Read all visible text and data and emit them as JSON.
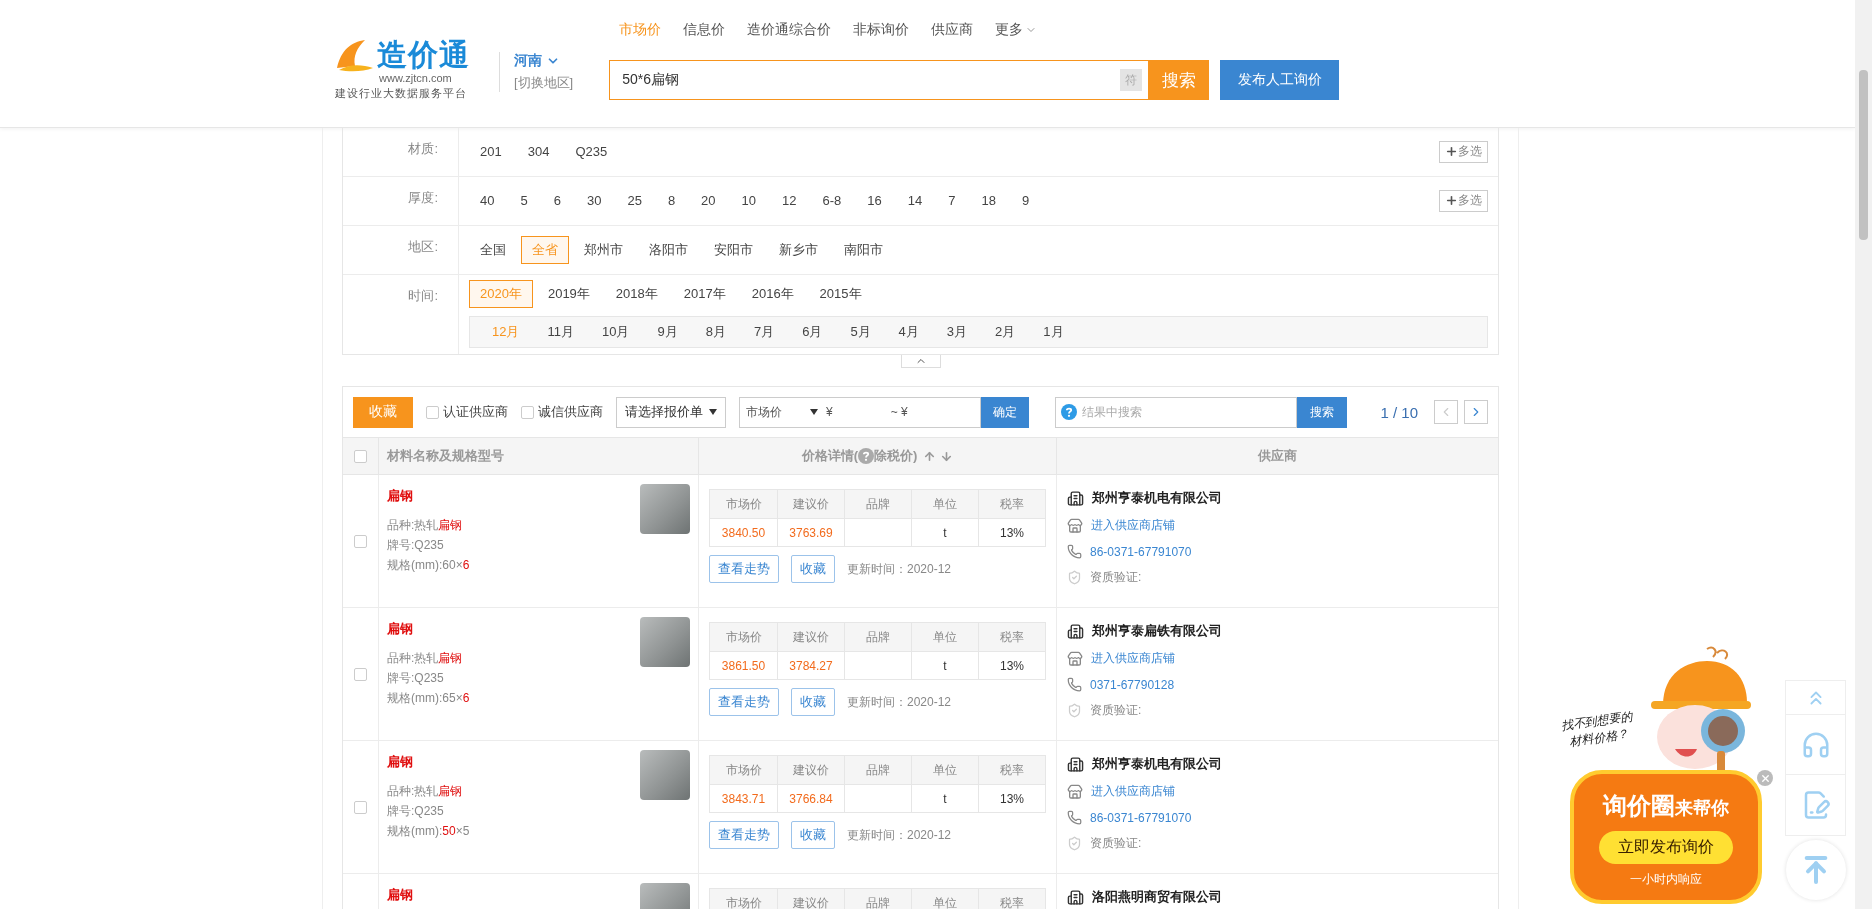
{
  "header": {
    "logo": {
      "name": "造价通",
      "url": "www.zjtcn.com",
      "slogan": "建设行业大数据服务平台"
    },
    "region": {
      "name": "河南",
      "switch": "[切换地区]"
    },
    "nav": [
      {
        "label": "市场价",
        "selected": true,
        "kind": "link"
      },
      {
        "label": "信息价",
        "selected": false,
        "kind": "link"
      },
      {
        "label": "造价通综合价",
        "selected": false,
        "kind": "link"
      },
      {
        "label": "非标询价",
        "selected": false,
        "kind": "link"
      },
      {
        "label": "供应商",
        "selected": false,
        "kind": "link"
      },
      {
        "label": "更多",
        "selected": false,
        "kind": "dropdown"
      }
    ],
    "search": {
      "value": "50*6扁钢",
      "symbol_button": "符",
      "button": "搜索"
    },
    "publish_button": "发布人工询价"
  },
  "filters": [
    {
      "label": "材质:",
      "multi": "多选",
      "options": [
        {
          "label": "201",
          "selected": false
        },
        {
          "label": "304",
          "selected": false
        },
        {
          "label": "Q235",
          "selected": false
        }
      ]
    },
    {
      "label": "厚度:",
      "multi": "多选",
      "options": [
        {
          "label": "40",
          "selected": false
        },
        {
          "label": "5",
          "selected": false
        },
        {
          "label": "6",
          "selected": false
        },
        {
          "label": "30",
          "selected": false
        },
        {
          "label": "25",
          "selected": false
        },
        {
          "label": "8",
          "selected": false
        },
        {
          "label": "20",
          "selected": false
        },
        {
          "label": "10",
          "selected": false
        },
        {
          "label": "12",
          "selected": false
        },
        {
          "label": "6-8",
          "selected": false
        },
        {
          "label": "16",
          "selected": false
        },
        {
          "label": "14",
          "selected": false
        },
        {
          "label": "7",
          "selected": false
        },
        {
          "label": "18",
          "selected": false
        },
        {
          "label": "9",
          "selected": false
        }
      ]
    },
    {
      "label": "地区:",
      "options": [
        {
          "label": "全国",
          "selected": false
        },
        {
          "label": "全省",
          "selected": true
        },
        {
          "label": "郑州市",
          "selected": false
        },
        {
          "label": "洛阳市",
          "selected": false
        },
        {
          "label": "安阳市",
          "selected": false
        },
        {
          "label": "新乡市",
          "selected": false
        },
        {
          "label": "南阳市",
          "selected": false
        }
      ]
    },
    {
      "label": "时间:",
      "options": [
        {
          "label": "2020年",
          "selected": true
        },
        {
          "label": "2019年",
          "selected": false
        },
        {
          "label": "2018年",
          "selected": false
        },
        {
          "label": "2017年",
          "selected": false
        },
        {
          "label": "2016年",
          "selected": false
        },
        {
          "label": "2015年",
          "selected": false
        }
      ],
      "months": [
        {
          "label": "12月",
          "selected": true
        },
        {
          "label": "11月",
          "selected": false
        },
        {
          "label": "10月",
          "selected": false
        },
        {
          "label": "9月",
          "selected": false
        },
        {
          "label": "8月",
          "selected": false
        },
        {
          "label": "7月",
          "selected": false
        },
        {
          "label": "6月",
          "selected": false
        },
        {
          "label": "5月",
          "selected": false
        },
        {
          "label": "4月",
          "selected": false
        },
        {
          "label": "3月",
          "selected": false
        },
        {
          "label": "2月",
          "selected": false
        },
        {
          "label": "1月",
          "selected": false
        }
      ]
    }
  ],
  "toolbar": {
    "collect_button": "收藏",
    "checkboxes": [
      {
        "label": "认证供应商",
        "checked": false
      },
      {
        "label": "诚信供应商",
        "checked": false
      }
    ],
    "quote_select": "请选择报价单",
    "price_type": "市场价",
    "price_from": "¥",
    "price_to": "~ ¥",
    "confirm_button": "确定",
    "result_search": {
      "placeholder": "结果中搜索",
      "button": "搜索"
    },
    "pager": "1 / 10"
  },
  "table": {
    "select_all_checked": false,
    "columns": [
      {
        "kind": "name",
        "label": "材料名称及规格型号"
      },
      {
        "kind": "price",
        "label": "价格详情(",
        "label_after": "除税价)"
      },
      {
        "kind": "supplier",
        "label": "供应商"
      }
    ],
    "rows": [
      {
        "checked": false,
        "title": "扁钢",
        "attrs": [
          [
            {
              "text": "品种:热轧",
              "highlight": false
            },
            {
              "text": "扁钢",
              "highlight": true
            }
          ],
          [
            {
              "text": "牌号:Q235",
              "highlight": false
            }
          ],
          [
            {
              "text": "规格(mm):60×",
              "highlight": false
            },
            {
              "text": "6",
              "highlight": true
            }
          ]
        ],
        "price_headers": [
          "市场价",
          "建议价",
          "品牌",
          "单位",
          "税率"
        ],
        "market": "3840.50",
        "suggested": "3763.69",
        "unit": "t",
        "tax": "13%",
        "trend_button": "查看走势",
        "collect_button": "收藏",
        "updated": "更新时间：2020-12",
        "supplier": "郑州亨泰机电有限公司",
        "shop_link": "进入供应商店铺",
        "phone": "86-0371-67791070",
        "cert": "资质验证:"
      },
      {
        "checked": false,
        "title": "扁钢",
        "attrs": [
          [
            {
              "text": "品种:热轧",
              "highlight": false
            },
            {
              "text": "扁钢",
              "highlight": true
            }
          ],
          [
            {
              "text": "牌号:Q235",
              "highlight": false
            }
          ],
          [
            {
              "text": "规格(mm):65×",
              "highlight": false
            },
            {
              "text": "6",
              "highlight": true
            }
          ]
        ],
        "price_headers": [
          "市场价",
          "建议价",
          "品牌",
          "单位",
          "税率"
        ],
        "market": "3861.50",
        "suggested": "3784.27",
        "unit": "t",
        "tax": "13%",
        "trend_button": "查看走势",
        "collect_button": "收藏",
        "updated": "更新时间：2020-12",
        "supplier": "郑州亨泰扁铁有限公司",
        "shop_link": "进入供应商店铺",
        "phone": "0371-67790128",
        "cert": "资质验证:"
      },
      {
        "checked": false,
        "title": "扁钢",
        "attrs": [
          [
            {
              "text": "品种:热轧",
              "highlight": false
            },
            {
              "text": "扁钢",
              "highlight": true
            }
          ],
          [
            {
              "text": "牌号:Q235",
              "highlight": false
            }
          ],
          [
            {
              "text": "规格(mm):",
              "highlight": false
            },
            {
              "text": "50",
              "highlight": true
            },
            {
              "text": "×5",
              "highlight": false
            }
          ]
        ],
        "price_headers": [
          "市场价",
          "建议价",
          "品牌",
          "单位",
          "税率"
        ],
        "market": "3843.71",
        "suggested": "3766.84",
        "unit": "t",
        "tax": "13%",
        "trend_button": "查看走势",
        "collect_button": "收藏",
        "updated": "更新时间：2020-12",
        "supplier": "郑州亨泰机电有限公司",
        "shop_link": "进入供应商店铺",
        "phone": "86-0371-67791070",
        "cert": "资质验证:"
      },
      {
        "title": "扁钢",
        "price_headers": [
          "市场价",
          "建议价",
          "品牌",
          "单位",
          "税率"
        ],
        "supplier": "洛阳燕明商贸有限公司"
      }
    ]
  },
  "promo": {
    "caption_line1": "找不到想要的",
    "caption_line2": "材料价格？",
    "title_big": "询价圈",
    "title_small": "来帮你",
    "button": "立即发布询价",
    "note": "一小时内响应"
  }
}
